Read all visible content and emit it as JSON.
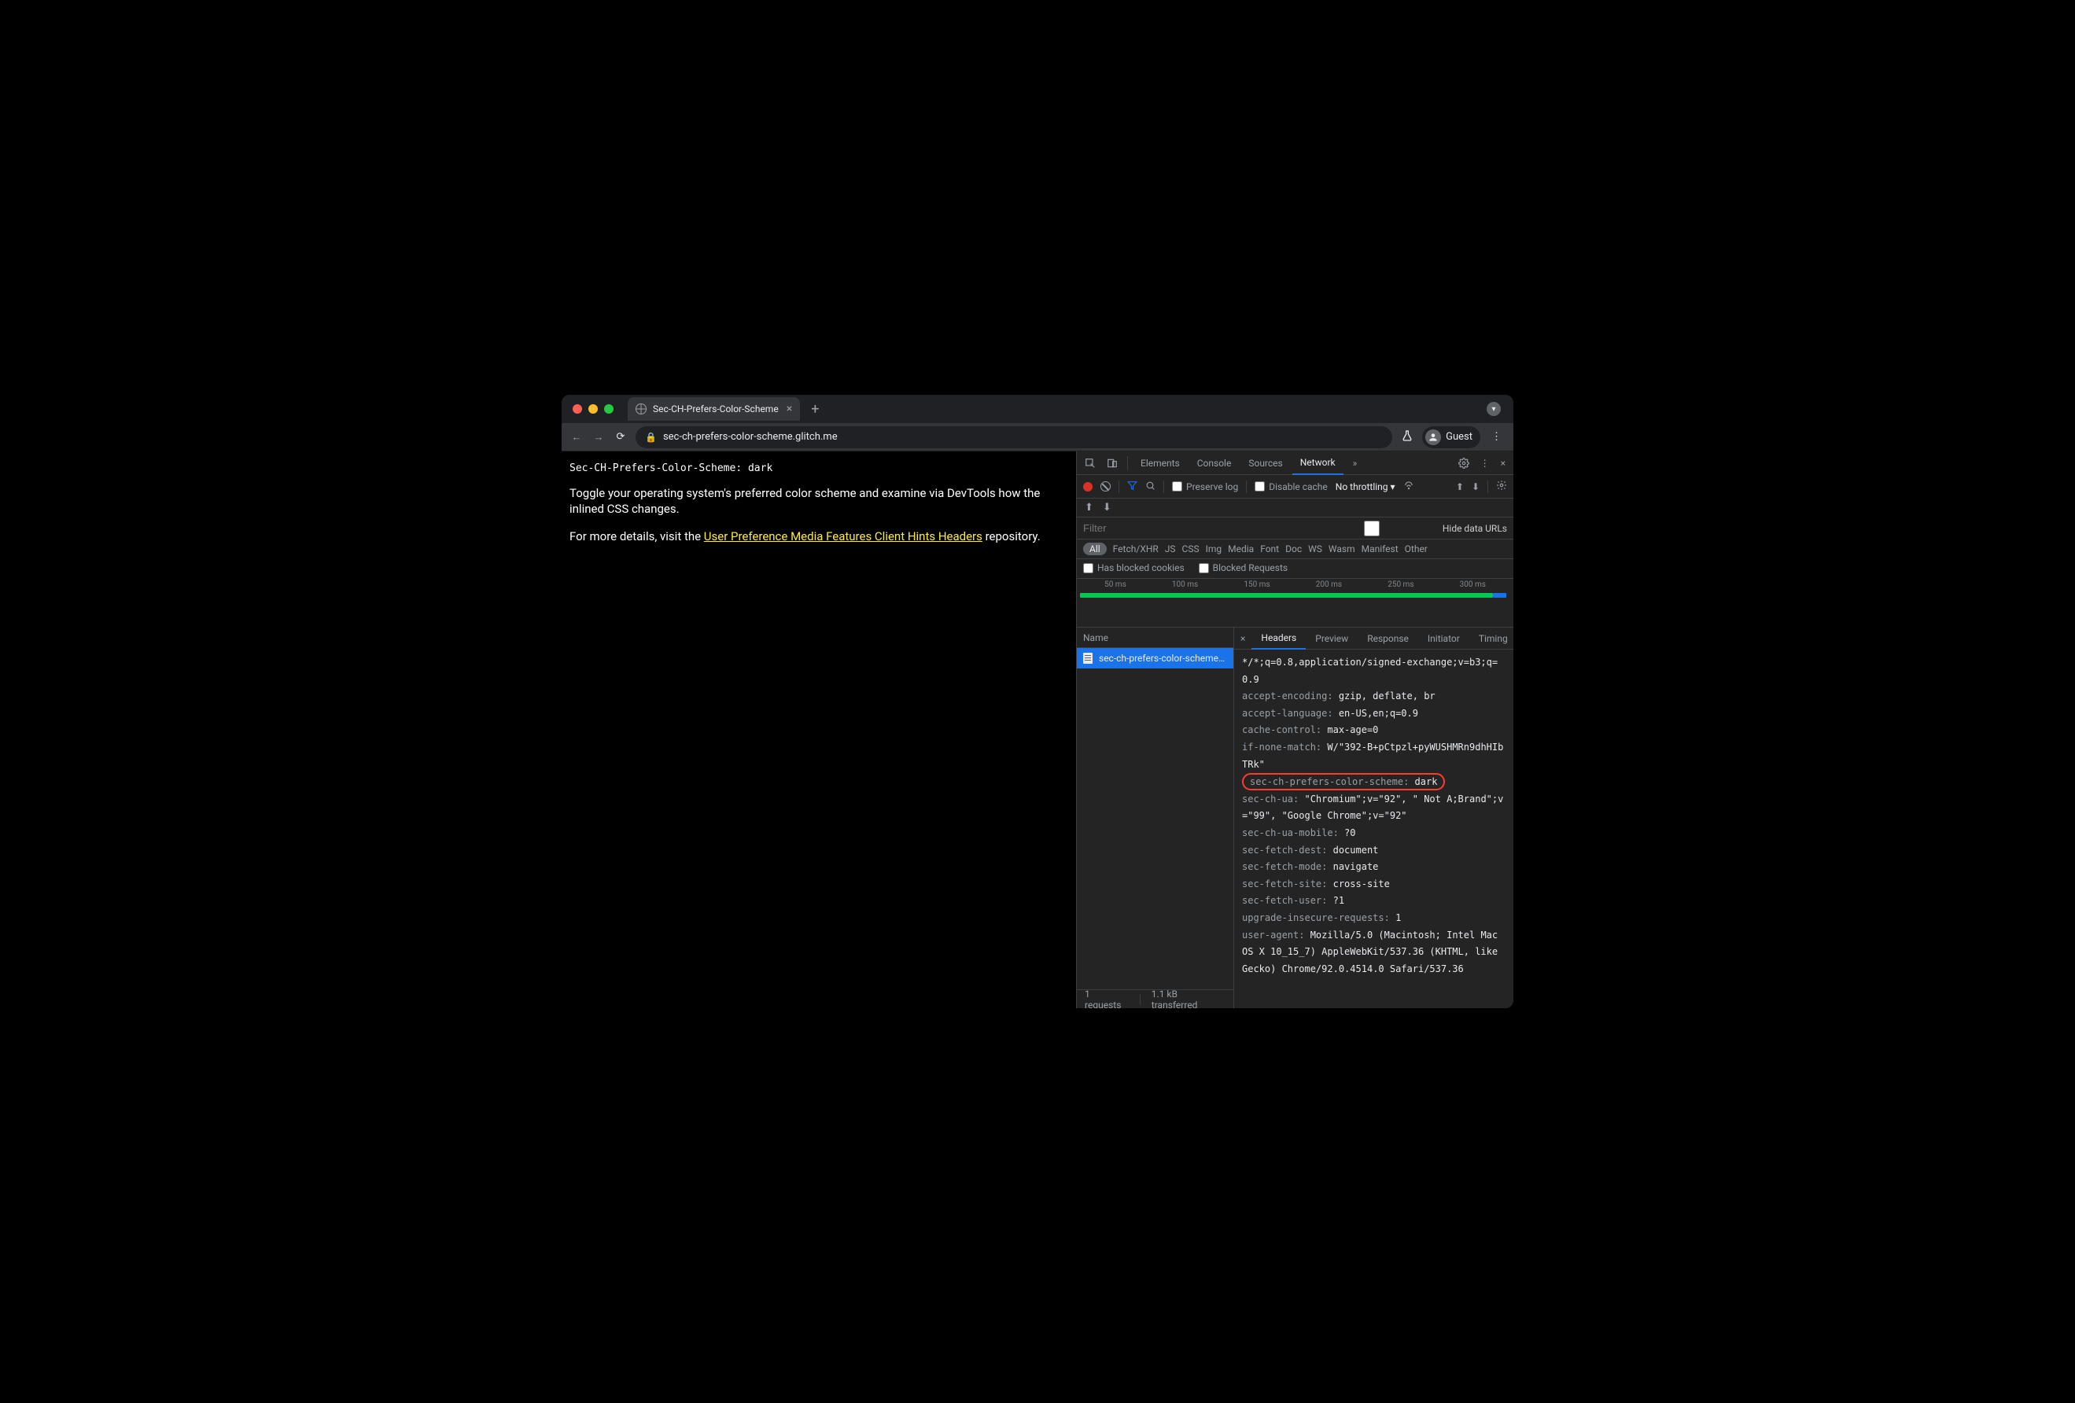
{
  "browser": {
    "tab_title": "Sec-CH-Prefers-Color-Scheme",
    "url": "sec-ch-prefers-color-scheme.glitch.me",
    "new_tab_tooltip": "+",
    "profile_label": "Guest"
  },
  "page": {
    "header_line": "Sec-CH-Prefers-Color-Scheme: dark",
    "para1": "Toggle your operating system's preferred color scheme and examine via DevTools how the inlined CSS changes.",
    "para2_prefix": "For more details, visit the ",
    "para2_link": "User Preference Media Features Client Hints Headers",
    "para2_suffix": " repository."
  },
  "devtools": {
    "tabs": {
      "elements": "Elements",
      "console": "Console",
      "sources": "Sources",
      "network": "Network",
      "more": "»"
    },
    "toolbar": {
      "preserve_log": "Preserve log",
      "disable_cache": "Disable cache",
      "throttling": "No throttling"
    },
    "filter_placeholder": "Filter",
    "hide_data_urls": "Hide data URLs",
    "types": [
      "All",
      "Fetch/XHR",
      "JS",
      "CSS",
      "Img",
      "Media",
      "Font",
      "Doc",
      "WS",
      "Wasm",
      "Manifest",
      "Other"
    ],
    "blocked_cookies": "Has blocked cookies",
    "blocked_requests": "Blocked Requests",
    "timeline_ticks": [
      "50 ms",
      "100 ms",
      "150 ms",
      "200 ms",
      "250 ms",
      "300 ms"
    ],
    "name_col": "Name",
    "request_name": "sec-ch-prefers-color-scheme…",
    "detail_tabs": {
      "headers": "Headers",
      "preview": "Preview",
      "response": "Response",
      "initiator": "Initiator",
      "timing": "Timing"
    },
    "headers": [
      {
        "raw": "*/*;q=0.8,application/signed-exchange;v=b3;q=0.9"
      },
      {
        "k": "accept-encoding:",
        "v": " gzip, deflate, br"
      },
      {
        "k": "accept-language:",
        "v": " en-US,en;q=0.9"
      },
      {
        "k": "cache-control:",
        "v": " max-age=0"
      },
      {
        "k": "if-none-match:",
        "v": " W/\"392-B+pCtpzl+pyWUSHMRn9dhHIbTRk\""
      },
      {
        "k": "sec-ch-prefers-color-scheme:",
        "v": " dark",
        "hl": true
      },
      {
        "k": "sec-ch-ua:",
        "v": " \"Chromium\";v=\"92\", \" Not A;Brand\";v=\"99\", \"Google Chrome\";v=\"92\""
      },
      {
        "k": "sec-ch-ua-mobile:",
        "v": " ?0"
      },
      {
        "k": "sec-fetch-dest:",
        "v": " document"
      },
      {
        "k": "sec-fetch-mode:",
        "v": " navigate"
      },
      {
        "k": "sec-fetch-site:",
        "v": " cross-site"
      },
      {
        "k": "sec-fetch-user:",
        "v": " ?1"
      },
      {
        "k": "upgrade-insecure-requests:",
        "v": " 1"
      },
      {
        "k": "user-agent:",
        "v": " Mozilla/5.0 (Macintosh; Intel Mac OS X 10_15_7) AppleWebKit/537.36 (KHTML, like Gecko) Chrome/92.0.4514.0 Safari/537.36"
      }
    ],
    "status": {
      "requests": "1 requests",
      "transferred": "1.1 kB transferred"
    }
  }
}
